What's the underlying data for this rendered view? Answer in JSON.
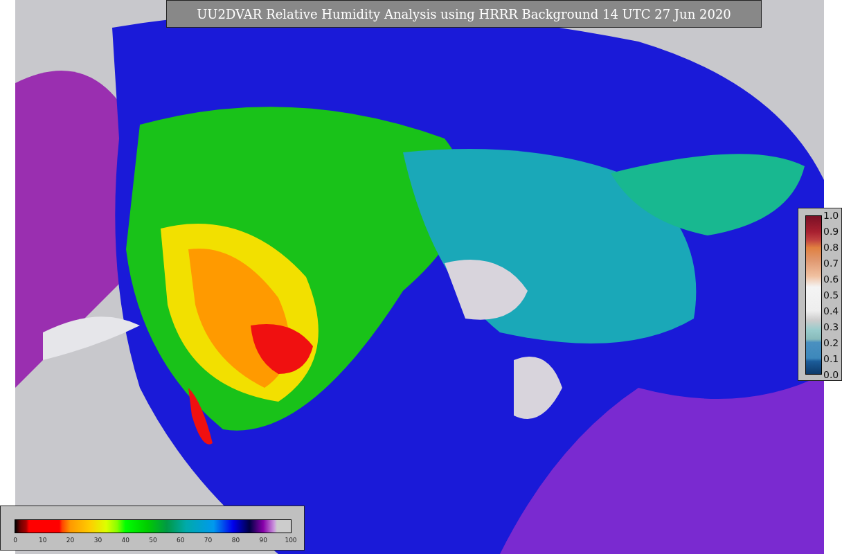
{
  "title": "UU2DVAR Relative Humidity Analysis using HRRR Background 14 UTC 27 Jun 2020",
  "humidity_colorbar": {
    "ticks": [
      "0",
      "10",
      "20",
      "30",
      "40",
      "50",
      "60",
      "70",
      "80",
      "90",
      "100"
    ]
  },
  "ratio_colorbar": {
    "ticks": [
      "1.0",
      "0.9",
      "0.8",
      "0.7",
      "0.6",
      "0.5",
      "0.4",
      "0.3",
      "0.2",
      "0.1",
      "0.0"
    ]
  }
}
